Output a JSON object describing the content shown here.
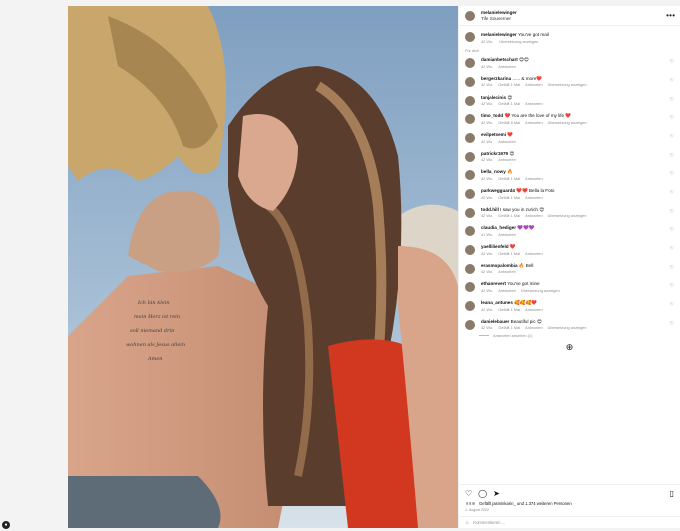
{
  "post": {
    "username": "melanielewinger",
    "subtitle": "Tife Souverner",
    "caption_user": "melanielewinger",
    "caption_text": "You've got mail",
    "caption_time": "42 Wo.",
    "caption_translate": "Übersetzung anzeigen",
    "for_you": "Für dich"
  },
  "comments": [
    {
      "user": "damianbetschart",
      "text": "😍😍",
      "time": "42 Wo.",
      "likes": "",
      "reply": "Antworten",
      "translate": ""
    },
    {
      "user": "bergerzkarina",
      "text": "...... & more❤️",
      "time": "42 Wo.",
      "likes": "Gefällt 1 Mal",
      "reply": "Antworten",
      "translate": "Übersetzung anzeigen"
    },
    {
      "user": "tanjalecinis",
      "text": "😍",
      "time": "42 Wo.",
      "likes": "Gefällt 1 Mal",
      "reply": "Antworten",
      "translate": ""
    },
    {
      "user": "timo_todd",
      "text": "❤️ You are the love of my life ❤️",
      "time": "42 Wo.",
      "likes": "Gefällt 8 Mal",
      "reply": "Antworten",
      "translate": "Übersetzung anzeigen"
    },
    {
      "user": "evilpetsemi",
      "text": "❤️",
      "time": "42 Wo.",
      "likes": "",
      "reply": "Antworten",
      "translate": ""
    },
    {
      "user": "patrickr1979",
      "text": "😍",
      "time": "42 Wo.",
      "likes": "",
      "reply": "Antworten",
      "translate": ""
    },
    {
      "user": "bella_nowy",
      "text": "🔥",
      "time": "42 Wo.",
      "likes": "Gefällt 1 Mal",
      "reply": "Antworten",
      "translate": ""
    },
    {
      "user": "parkwegguard4",
      "text": "❤️❤️ Bella la Foto",
      "time": "42 Wo.",
      "likes": "Gefällt 1 Mal",
      "reply": "Antworten",
      "translate": ""
    },
    {
      "user": "todd.hill",
      "text": "I saw you in zurich 😍",
      "time": "42 Wo.",
      "likes": "Gefällt 1 Mal",
      "reply": "Antworten",
      "translate": "Übersetzung anzeigen"
    },
    {
      "user": "claudia_hediger",
      "text": "💜💜💜",
      "time": "41 Wo.",
      "likes": "",
      "reply": "Antworten",
      "translate": ""
    },
    {
      "user": "yaellilienfeld",
      "text": "❤️",
      "time": "42 Wo.",
      "likes": "Gefällt 1 Mal",
      "reply": "Antworten",
      "translate": ""
    },
    {
      "user": "erasmopalombia",
      "text": "🔥 Bell",
      "time": "42 Wo.",
      "likes": "",
      "reply": "Antworten",
      "translate": ""
    },
    {
      "user": "ethanrevert",
      "text": "You've got mine",
      "time": "42 Wo.",
      "likes": "",
      "reply": "Antworten",
      "translate": "Übersetzung anzeigen"
    },
    {
      "user": "leana_antunes",
      "text": "🥰🥰🥰❤️",
      "time": "42 Wo.",
      "likes": "Gefällt 1 Mal",
      "reply": "Antworten",
      "translate": ""
    },
    {
      "user": "danielebauer",
      "text": "Beautiful pic 😍",
      "time": "42 Wo.",
      "likes": "Gefällt 1 Mal",
      "reply": "Antworten",
      "translate": "Übersetzung anzeigen"
    }
  ],
  "replies_label": "Antworten ansehen (1)",
  "footer": {
    "likes_text": "Gefällt jasminkarin_ und 1.374 weiteren Personen",
    "date": "1. August 2022",
    "add_comment_placeholder": "Kommentieren ..."
  },
  "icons": {
    "more": "more-icon",
    "heart": "heart-icon",
    "comment": "comment-icon",
    "share": "share-icon",
    "save": "bookmark-icon",
    "plus": "plus-circle-icon",
    "emoji": "emoji-icon"
  },
  "colors": {
    "accent_red": "#e0245e",
    "muted": "#8e8e8e"
  }
}
